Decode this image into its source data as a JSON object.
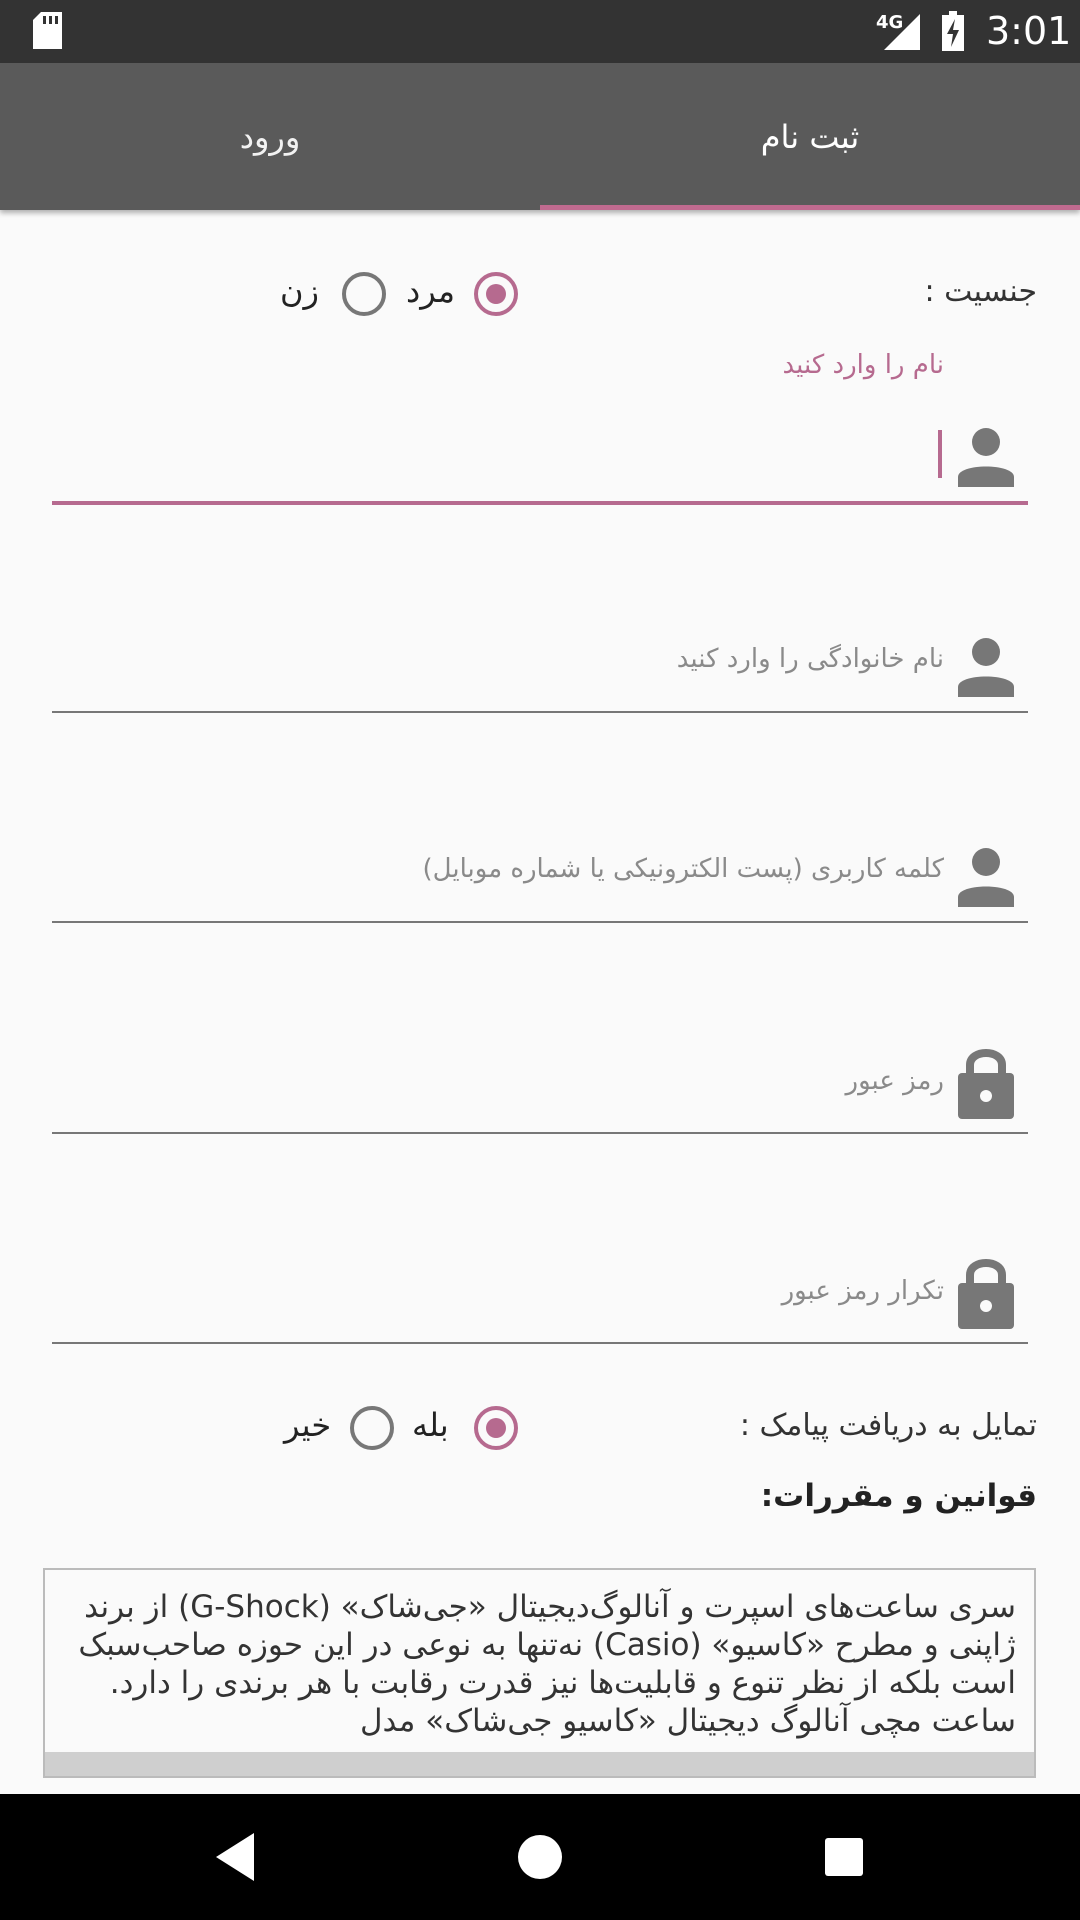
{
  "status_bar": {
    "network": "4G",
    "time": "3:01"
  },
  "tabs": {
    "register": "ثبت نام",
    "login": "ورود"
  },
  "gender": {
    "label": "جنسیت :",
    "male": "مرد",
    "female": "زن",
    "selected": "مرد"
  },
  "fields": {
    "first_name_label": "نام را وارد کنید",
    "last_name_placeholder": "نام خانوادگی را وارد کنید",
    "username_placeholder": "کلمه کاربری (پست الکترونیکی یا شماره موبایل)",
    "password_placeholder": "رمز عبور",
    "password_repeat_placeholder": "تکرار رمز عبور"
  },
  "sms": {
    "label": "تمایل به دریافت پیامک :",
    "yes": "بله",
    "no": "خیر",
    "selected": "بله"
  },
  "terms": {
    "title": "قوانین و مقررات:",
    "text": "سری ساعت‌های اسپرت و آنالوگ‌دیجیتال «جی‌شاک» (G-Shock) از برند ژاپنی و مطرح «کاسیو» (Casio) نه‌تنها به نوعی در این حوزه صاحب‌سبک است بلکه از نظر تنوع و قابلیت‌ها نیز قدرت رقابت با هر برندی را دارد. ساعت مچی آنالوگ دیجیتال «کاسیو جی‌شاک» مدل"
  },
  "colors": {
    "accent": "#b66a8f",
    "tab_bar": "#5a5a5a",
    "status_bar": "#333333"
  }
}
